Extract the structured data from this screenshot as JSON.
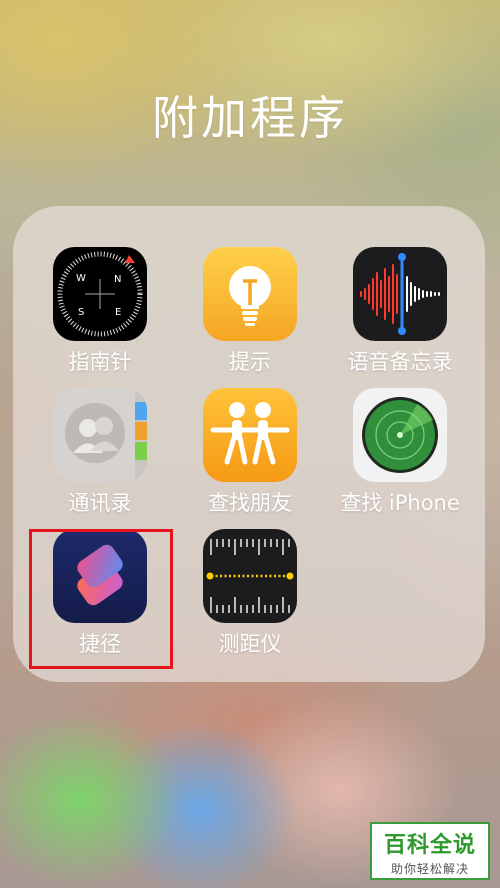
{
  "folder": {
    "title": "附加程序",
    "apps": [
      {
        "label": "指南针",
        "icon": "compass-icon"
      },
      {
        "label": "提示",
        "icon": "tips-lightbulb-icon"
      },
      {
        "label": "语音备忘录",
        "icon": "voice-memos-waveform-icon"
      },
      {
        "label": "通讯录",
        "icon": "contacts-icon"
      },
      {
        "label": "查找朋友",
        "icon": "find-friends-icon"
      },
      {
        "label": "查找 iPhone",
        "icon": "find-iphone-radar-icon"
      },
      {
        "label": "捷径",
        "icon": "shortcuts-icon"
      },
      {
        "label": "测距仪",
        "icon": "measure-ruler-icon"
      }
    ]
  },
  "compass": {
    "n": "N",
    "w": "W",
    "s": "S",
    "e": "E"
  },
  "highlight_color": "#e3141b",
  "watermark": {
    "title": "百科全说",
    "subtitle": "助你轻松解决"
  }
}
